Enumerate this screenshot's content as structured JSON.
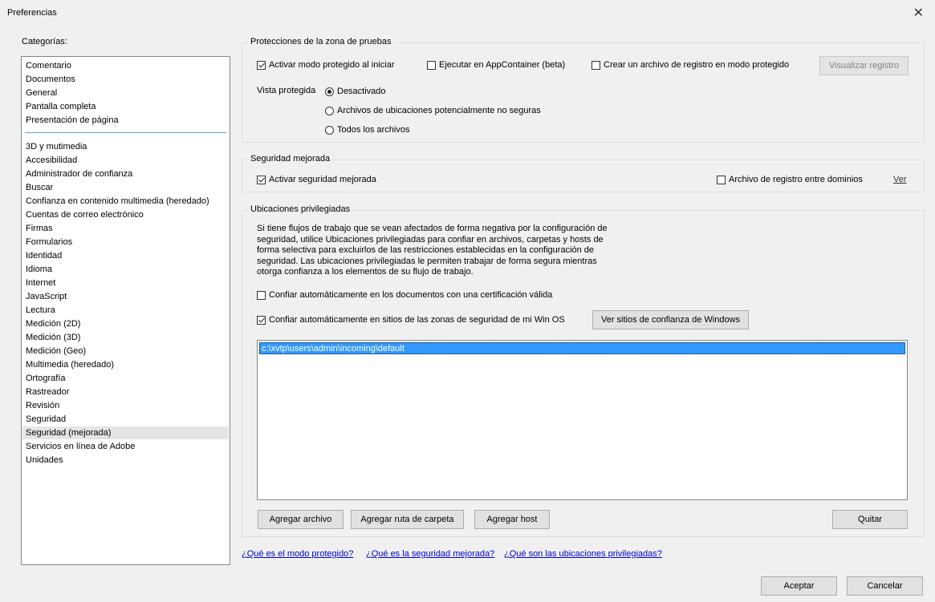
{
  "window": {
    "title": "Preferencias",
    "close_glyph": "✕"
  },
  "categories": {
    "label": "Categorías:",
    "top_items": [
      "Comentario",
      "Documentos",
      "General",
      "Pantalla completa",
      "Presentación de página"
    ],
    "items": [
      "3D y mutimedia",
      "Accesibilidad",
      "Administrador de confianza",
      "Buscar",
      "Confianza en contenido multimedia (heredado)",
      "Cuentas de correo electrónico",
      "Firmas",
      "Formularios",
      "Identidad",
      "Idioma",
      "Internet",
      "JavaScript",
      "Lectura",
      "Medición (2D)",
      "Medición (3D)",
      "Medición (Geo)",
      "Multimedia (heredado)",
      "Ortografía",
      "Rastreador",
      "Revisión",
      "Seguridad",
      "Seguridad (mejorada)",
      "Servicios en línea de Adobe",
      "Unidades"
    ],
    "selected": "Seguridad (mejorada)"
  },
  "sandbox": {
    "title": "Protecciones de la zona de pruebas",
    "protected_mode": {
      "label": "Activar modo protegido al iniciar",
      "checked": true
    },
    "appcontainer": {
      "label": "Ejecutar en AppContainer (beta)",
      "checked": false
    },
    "log_file": {
      "label": "Crear un archivo de registro en modo protegido",
      "checked": false
    },
    "view_log_button": "Visualizar registro",
    "protected_view_label": "Vista protegida",
    "radio_options": [
      "Desactivado",
      "Archivos de ubicaciones potencialmente no seguras",
      "Todos los archivos"
    ],
    "radio_selected": "Desactivado"
  },
  "enhanced": {
    "title": "Seguridad mejorada",
    "enable": {
      "label": "Activar seguridad mejorada",
      "checked": true
    },
    "cross_domain_log": {
      "label": "Archivo de registro entre dominios",
      "checked": false
    },
    "view_link": "Ver"
  },
  "privileged": {
    "title": "Ubicaciones privilegiadas",
    "description_lines": [
      "Si tiene flujos de trabajo que se vean afectados de forma negativa por la configuración de",
      "seguridad, utilice Ubicaciones privilegiadas para confiar en archivos, carpetas y hosts de",
      "forma selectiva para excluirlos de las restricciones establecidas en la configuración de",
      "seguridad. Las ubicaciones privilegiadas le permiten trabajar de forma segura mientras",
      "otorga confianza a los elementos de su flujo de trabajo."
    ],
    "trust_certified": {
      "label": "Confiar automáticamente en los documentos con una certificación válida",
      "checked": false
    },
    "trust_win_zones": {
      "label": "Confiar automáticamente en sitios de las zonas de seguridad de mi Win OS",
      "checked": true
    },
    "view_win_sites_button": "Ver sitios de confianza de Windows",
    "locations": [
      "c:\\xvtp\\users\\admin\\incoming\\default"
    ],
    "add_file_button": "Agregar archivo",
    "add_folder_button": "Agregar ruta de carpeta",
    "add_host_button": "Agregar host",
    "remove_button": "Quitar"
  },
  "help_links": [
    "¿Qué es el modo protegido?",
    "¿Qué es la seguridad mejorada?",
    "¿Qué son las ubicaciones privilegiadas?"
  ],
  "footer": {
    "ok_button": "Aceptar",
    "cancel_button": "Cancelar"
  }
}
